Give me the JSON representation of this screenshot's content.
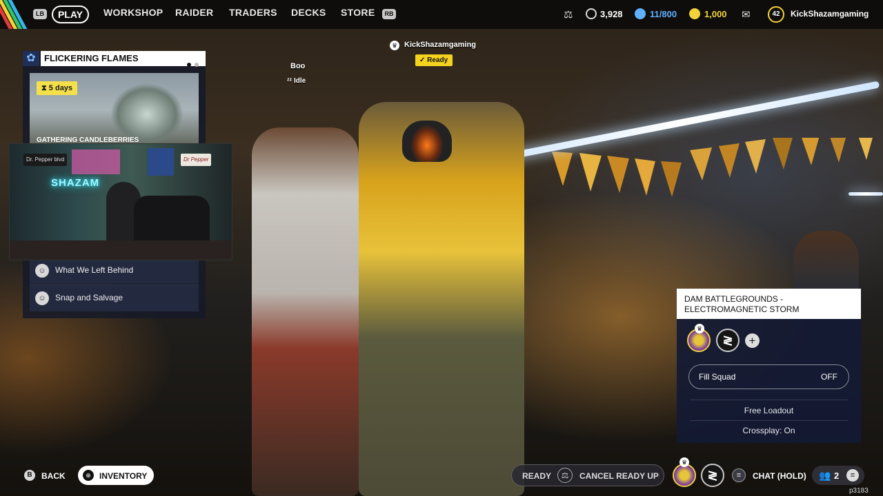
{
  "topbar": {
    "left_bumper": "LB",
    "right_bumper": "RB",
    "tabs": [
      {
        "label": "PLAY",
        "active": true
      },
      {
        "label": "WORKSHOP"
      },
      {
        "label": "RAIDER"
      },
      {
        "label": "TRADERS"
      },
      {
        "label": "DECKS"
      },
      {
        "label": "STORE"
      }
    ],
    "currencies": [
      {
        "icon": "credits-icon",
        "value": "3,928"
      },
      {
        "icon": "storage-icon",
        "value": "11/800",
        "color": "#5fb0ff"
      },
      {
        "icon": "coins-icon",
        "value": "1,000",
        "color": "#f2d43a"
      }
    ],
    "level": "42",
    "username": "KickShazamgaming"
  },
  "event": {
    "title": "FLICKERING FLAMES",
    "timer": "5  days",
    "image_caption": "GATHERING CANDLEBERRIES",
    "quests": [
      {
        "label": "What We Left Behind"
      },
      {
        "label": "Snap and Salvage"
      }
    ]
  },
  "players": {
    "leader_name": "KickShazamgaming",
    "leader_status": "Ready",
    "friend_name": "Boo",
    "friend_status": "Idle"
  },
  "map": {
    "title_line1": "DAM BATTLEGROUNDS -",
    "title_line2": "ELECTROMAGNETIC STORM",
    "fill_squad_label": "Fill Squad",
    "fill_squad_value": "OFF",
    "loadout": "Free Loadout",
    "crossplay": "Crossplay: On"
  },
  "bottom": {
    "back_key": "B",
    "back_label": "BACK",
    "inventory_label": "INVENTORY",
    "ready_label": "READY",
    "cancel_label": "CANCEL READY UP",
    "chat_label": "CHAT (HOLD)",
    "party_count": "2",
    "build": "p3183"
  },
  "webcam": {
    "neon_text": "SHAZAM",
    "sign1": "Dr. Pepper blvd",
    "sign2": "Dr Pepper"
  },
  "colors": {
    "accent_yellow": "#f4d21d",
    "panel_navy": "#141a34",
    "storage_blue": "#5fb0ff"
  }
}
